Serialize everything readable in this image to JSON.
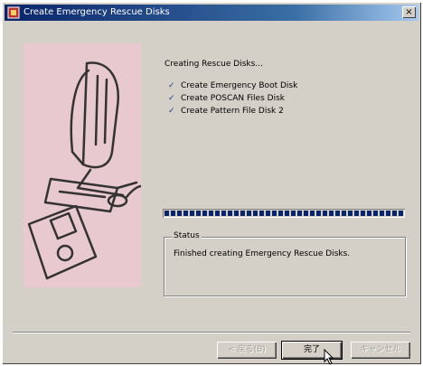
{
  "window": {
    "title": "Create Emergency Rescue Disks",
    "close_label": "×"
  },
  "main": {
    "heading": "Creating Rescue Disks...",
    "steps": [
      {
        "label": "Create Emergency Boot Disk"
      },
      {
        "label": "Create POSCAN Files Disk"
      },
      {
        "label": "Create Pattern File Disk 2"
      }
    ],
    "progress": {
      "fraction": 1.0
    },
    "status": {
      "legend": "Status",
      "message": "Finished creating Emergency Rescue Disks."
    }
  },
  "buttons": {
    "back": "< 戻る(B)",
    "finish": "完了",
    "cancel": "キャンセル"
  },
  "colors": {
    "illustration_bg": "#e8c9d0",
    "titlebar": "#0a246a",
    "progress": "#0a246a"
  }
}
